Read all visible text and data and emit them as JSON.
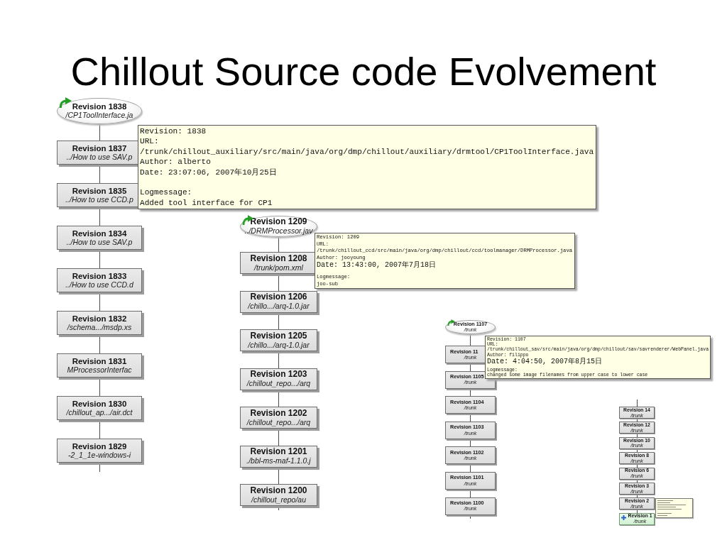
{
  "slide": {
    "title": "Chillout Source code Evolvement"
  },
  "graphs": [
    {
      "nodes": [
        {
          "kind": "head",
          "revision": "Revision 1838",
          "path": "/CP1ToolInterface.ja"
        },
        {
          "kind": "modified",
          "revision": "Revision 1837",
          "path": "../How to use SAV.p"
        },
        {
          "kind": "modified",
          "revision": "Revision 1835",
          "path": "../How to use CCD.p"
        },
        {
          "kind": "modified",
          "revision": "Revision 1834",
          "path": "../How to use SAV.p"
        },
        {
          "kind": "modified",
          "revision": "Revision 1833",
          "path": "../How to use CCD.d"
        },
        {
          "kind": "modified",
          "revision": "Revision 1832",
          "path": "/schema.../msdp.xs"
        },
        {
          "kind": "modified",
          "revision": "Revision 1831",
          "path": "MProcessorInterfac"
        },
        {
          "kind": "modified",
          "revision": "Revision 1830",
          "path": "/chillout_ap.../air.dct"
        },
        {
          "kind": "modified",
          "revision": "Revision 1829",
          "path": "-2_1_1e-windows-i"
        }
      ],
      "tooltip": {
        "revision": "Revision: 1838",
        "url_label": "URL:",
        "url": "/trunk/chillout_auxiliary/src/main/java/org/dmp/chillout/auxiliary/drmtool/CP1ToolInterface.java",
        "author": "Author: alberto",
        "date": "Date: 23:07:06, 2007年10月25日",
        "log_label": "Logmessage:",
        "log_message": "Added tool interface for CP1"
      }
    },
    {
      "nodes": [
        {
          "kind": "head",
          "revision": "Revision 1209",
          "path": "../DRMProcessor.jav"
        },
        {
          "kind": "modified",
          "revision": "Revision 1208",
          "path": "/trunk/pom.xml"
        },
        {
          "kind": "modified",
          "revision": "Revision 1206",
          "path": "/chillo.../arq-1.0.jar"
        },
        {
          "kind": "modified",
          "revision": "Revision 1205",
          "path": "/chillo.../arq-1.0.jar"
        },
        {
          "kind": "modified",
          "revision": "Revision 1203",
          "path": "/chillout_repo.../arq"
        },
        {
          "kind": "modified",
          "revision": "Revision 1202",
          "path": "/chillout_repo.../arq"
        },
        {
          "kind": "modified",
          "revision": "Revision 1201",
          "path": "./bbl-ms-maf-1.1.0.j"
        },
        {
          "kind": "modified",
          "revision": "Revision 1200",
          "path": "/chillout_repo/au"
        }
      ],
      "tooltip": {
        "revision": "Revision: 1209",
        "url_label": "URL:",
        "url": "/trunk/chillout_ccd/src/main/java/org/dmp/chillout/ccd/toolmanager/DRMProcessor.java",
        "author": "Author: jooyoung",
        "date": "Date: 13:43:00, 2007年7月18日",
        "log_label": "Logmessage:",
        "log_message": "joo-sub"
      }
    },
    {
      "nodes": [
        {
          "kind": "head",
          "revision": "Revision 1107",
          "path": "/trunk"
        },
        {
          "kind": "modified",
          "revision": "Revision 11",
          "path": "/trunk"
        },
        {
          "kind": "modified",
          "revision": "Revision 1105",
          "path": "/trunk"
        },
        {
          "kind": "modified",
          "revision": "Revision 1104",
          "path": "/trunk"
        },
        {
          "kind": "modified",
          "revision": "Revision 1103",
          "path": "/trunk"
        },
        {
          "kind": "modified",
          "revision": "Revision 1102",
          "path": "/trunk"
        },
        {
          "kind": "modified",
          "revision": "Revision 1101",
          "path": "/trunk"
        },
        {
          "kind": "modified",
          "revision": "Revision 1100",
          "path": "/trunk"
        }
      ],
      "tooltip": {
        "revision": "Revision: 1107",
        "url_label": "URL:",
        "url": "/trunk/chillout_sav/src/main/java/org/dmp/chillout/sav/savrenderer/WebPanel.java",
        "author": "Author: filippo",
        "date": "Date: 4:04:50, 2007年8月15日",
        "log_label": "Logmessage:",
        "log_message": "changed some image filenames from upper case to lower case"
      }
    },
    {
      "nodes": [
        {
          "kind": "modified",
          "revision": "Revision 14",
          "path": "/trunk"
        },
        {
          "kind": "modified",
          "revision": "Revision 12",
          "path": "/trunk"
        },
        {
          "kind": "modified",
          "revision": "Revision 10",
          "path": "/trunk"
        },
        {
          "kind": "modified",
          "revision": "Revision 8",
          "path": "/trunk"
        },
        {
          "kind": "modified",
          "revision": "Revision 6",
          "path": "/trunk"
        },
        {
          "kind": "modified",
          "revision": "Revision 3",
          "path": "/trunk"
        },
        {
          "kind": "modified",
          "revision": "Revision 2",
          "path": "/trunk"
        },
        {
          "kind": "added",
          "revision": "Revision 1",
          "path": "/trunk"
        }
      ]
    }
  ]
}
